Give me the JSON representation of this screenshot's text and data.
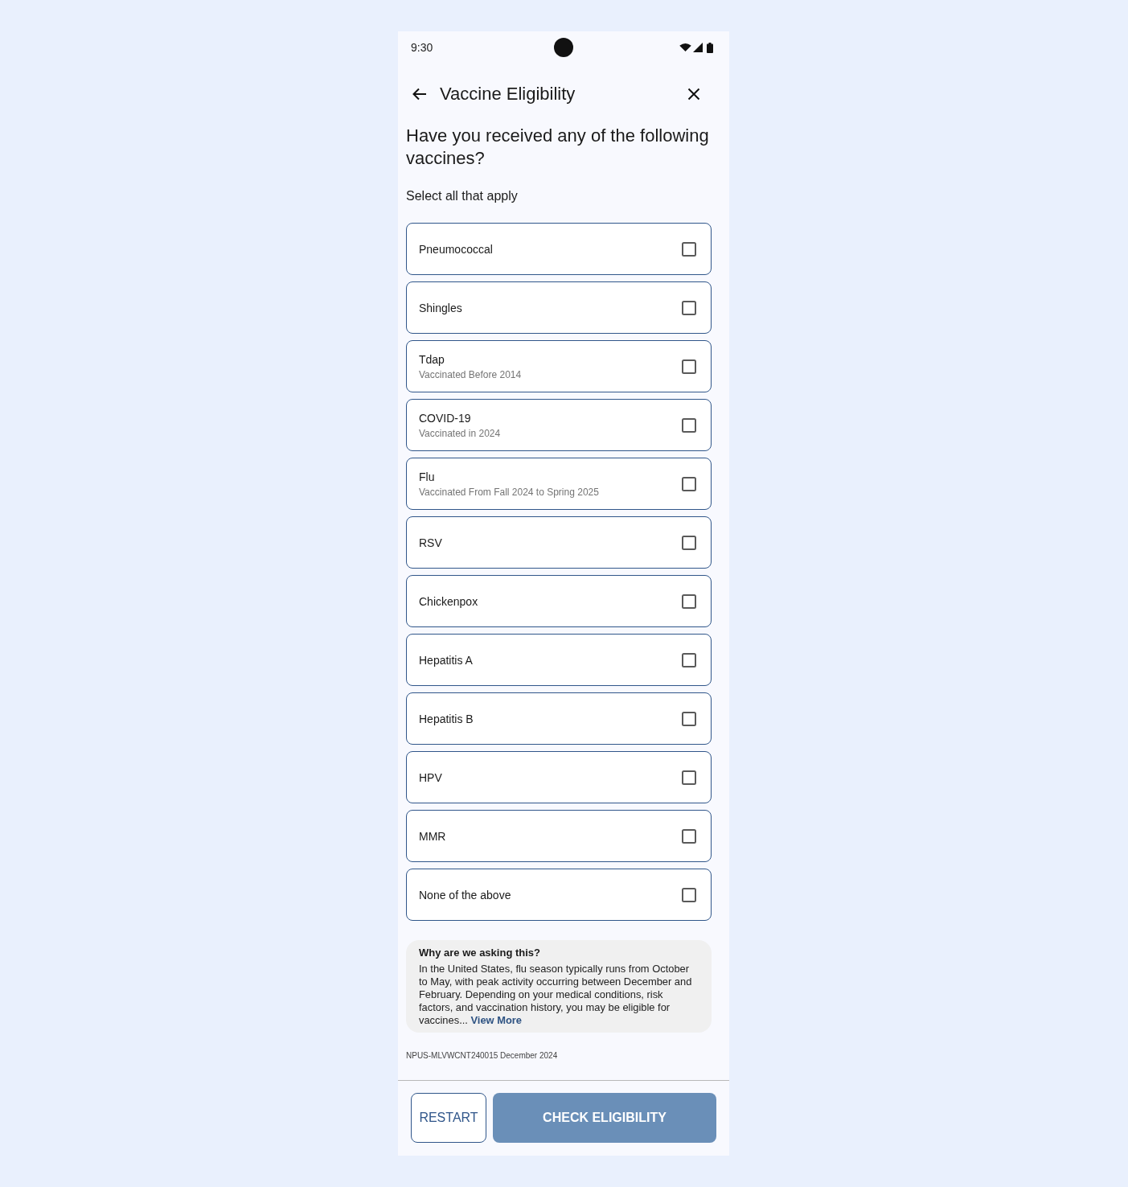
{
  "status_bar": {
    "time": "9:30"
  },
  "header": {
    "title": "Vaccine Eligibility"
  },
  "question": "Have you received any of the following vaccines?",
  "instruction": "Select all that apply",
  "options": [
    {
      "label": "Pneumococcal",
      "checked": false
    },
    {
      "label": "Shingles",
      "checked": false
    },
    {
      "label": "Tdap",
      "note": "Vaccinated Before 2014",
      "checked": false
    },
    {
      "label": "COVID-19",
      "note": "Vaccinated in 2024",
      "checked": false
    },
    {
      "label": "Flu",
      "note": "Vaccinated From Fall 2024 to Spring 2025",
      "checked": false
    },
    {
      "label": "RSV",
      "checked": false
    },
    {
      "label": "Chickenpox",
      "checked": false
    },
    {
      "label": "Hepatitis A",
      "checked": false
    },
    {
      "label": "Hepatitis B",
      "checked": false
    },
    {
      "label": "HPV",
      "checked": false
    },
    {
      "label": "MMR",
      "checked": false
    },
    {
      "label": "None of the above",
      "checked": false
    }
  ],
  "info": {
    "title": "Why are we asking this?",
    "text": "In the United States, flu season typically runs from October to May, with peak activity occurring between December and February. Depending on your medical conditions, risk factors, and vaccination history, you may be eligible for vaccines...",
    "link": "View More"
  },
  "footnote": "NPUS-MLVWCNT240015 December 2024",
  "buttons": [
    {
      "label": "RESTART",
      "kind": "outlined",
      "disabled": false
    },
    {
      "label": "CHECK ELIGIBILITY",
      "kind": "filled",
      "disabled": true
    }
  ]
}
